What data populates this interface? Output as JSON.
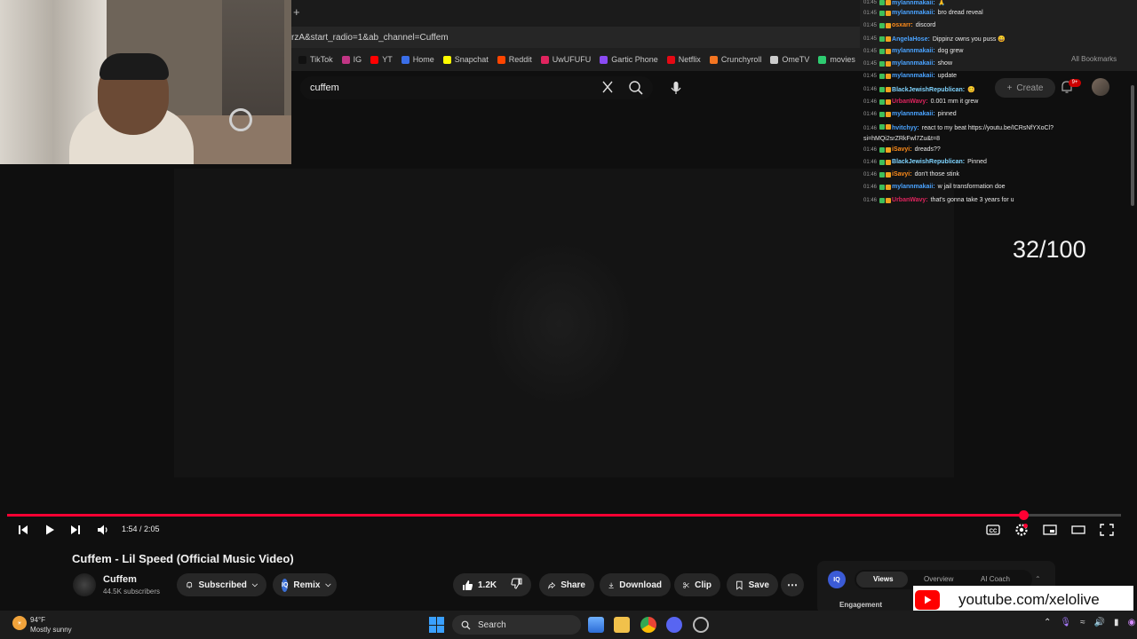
{
  "browser": {
    "address": "rzA&start_radio=1&ab_channel=Cuffem",
    "bookmarks": [
      {
        "label": "TikTok",
        "color": "#111111"
      },
      {
        "label": "IG",
        "color": "#c13584"
      },
      {
        "label": "YT",
        "color": "#ff0000"
      },
      {
        "label": "Home",
        "color": "#3a6ee8"
      },
      {
        "label": "Snapchat",
        "color": "#fffc00"
      },
      {
        "label": "Reddit",
        "color": "#ff4500"
      },
      {
        "label": "UwUFUFU",
        "color": "#e0245e"
      },
      {
        "label": "Gartic Phone",
        "color": "#8a4af3"
      },
      {
        "label": "Netflix",
        "color": "#e50914"
      },
      {
        "label": "Crunchyroll",
        "color": "#f47521"
      },
      {
        "label": "OmeTV",
        "color": "#cccccc"
      },
      {
        "label": "movies",
        "color": "#2ecc71"
      }
    ],
    "all_bookmarks": "All Bookmarks"
  },
  "search": {
    "query": "cuffem"
  },
  "header": {
    "create_label": "Create",
    "notifications_badge": "9+"
  },
  "chat": {
    "messages": [
      {
        "time": "01:45",
        "user": "mylannmakaii:",
        "user_color": "#4aa3ff",
        "text": "🙏"
      },
      {
        "time": "01:45",
        "user": "mylannmakaii:",
        "user_color": "#4aa3ff",
        "text": "bro dread reveal"
      },
      {
        "time": "01:45",
        "user": "osxarr:",
        "user_color": "#ff8c1a",
        "text": "discord"
      },
      {
        "time": "01:45",
        "user": "AngelaHose:",
        "user_color": "#4aa3ff",
        "text": "Dippinz owns you puss 😄"
      },
      {
        "time": "01:45",
        "user": "mylannmakaii:",
        "user_color": "#4aa3ff",
        "text": "dog grew"
      },
      {
        "time": "01:45",
        "user": "mylannmakaii:",
        "user_color": "#4aa3ff",
        "text": "show"
      },
      {
        "time": "01:45",
        "user": "mylannmakaii:",
        "user_color": "#4aa3ff",
        "text": "update"
      },
      {
        "time": "01:46",
        "user": "BlackJewishRepublican:",
        "user_color": "#7fd4ff",
        "text": "😊"
      },
      {
        "time": "01:46",
        "user": "UrbanWavy:",
        "user_color": "#e0245e",
        "text": "0.001 mm it grew"
      },
      {
        "time": "01:46",
        "user": "mylannmakaii:",
        "user_color": "#4aa3ff",
        "text": "pinned"
      },
      {
        "time": "01:46",
        "user": "hvitchyy:",
        "user_color": "#4aa3ff",
        "text": "react to my beat https://youtu.be/ICRsNfYXoCl?si=hMQi2srZRkFwl7Zu&t=8"
      },
      {
        "time": "01:46",
        "user": "iSavyi:",
        "user_color": "#ff8c1a",
        "text": "dreads??"
      },
      {
        "time": "01:46",
        "user": "BlackJewishRepublican:",
        "user_color": "#7fd4ff",
        "text": "Pinned"
      },
      {
        "time": "01:46",
        "user": "iSavyi:",
        "user_color": "#ff8c1a",
        "text": "don't those stink"
      },
      {
        "time": "01:46",
        "user": "mylannmakaii:",
        "user_color": "#4aa3ff",
        "text": "w jail transformation doe"
      },
      {
        "time": "01:46",
        "user": "UrbanWavy:",
        "user_color": "#e0245e",
        "text": "that's gonna take 3 years for u"
      }
    ]
  },
  "overlay": {
    "counter": "32/100"
  },
  "player": {
    "time_display": "1:54 / 2:05",
    "progress": 0.912
  },
  "video": {
    "title": "Cuffem - Lil Speed (Official Music Video)",
    "channel_name": "Cuffem",
    "subscribers": "44.5K subscribers",
    "subscribed_label": "Subscribed",
    "remix_label": "Remix",
    "likes": "1.2K",
    "share_label": "Share",
    "download_label": "Download",
    "clip_label": "Clip",
    "save_label": "Save"
  },
  "side_widget": {
    "logo_text": "IQ",
    "tabs": [
      "Views",
      "Overview",
      "AI Coach"
    ],
    "section": "Engagement"
  },
  "banner": {
    "text": "youtube.com/xelolive"
  },
  "taskbar": {
    "temp": "94°F",
    "weather": "Mostly sunny",
    "search_label": "Search"
  },
  "colors": {
    "accent_red": "#ff0033",
    "background": "#0f0f0f"
  }
}
